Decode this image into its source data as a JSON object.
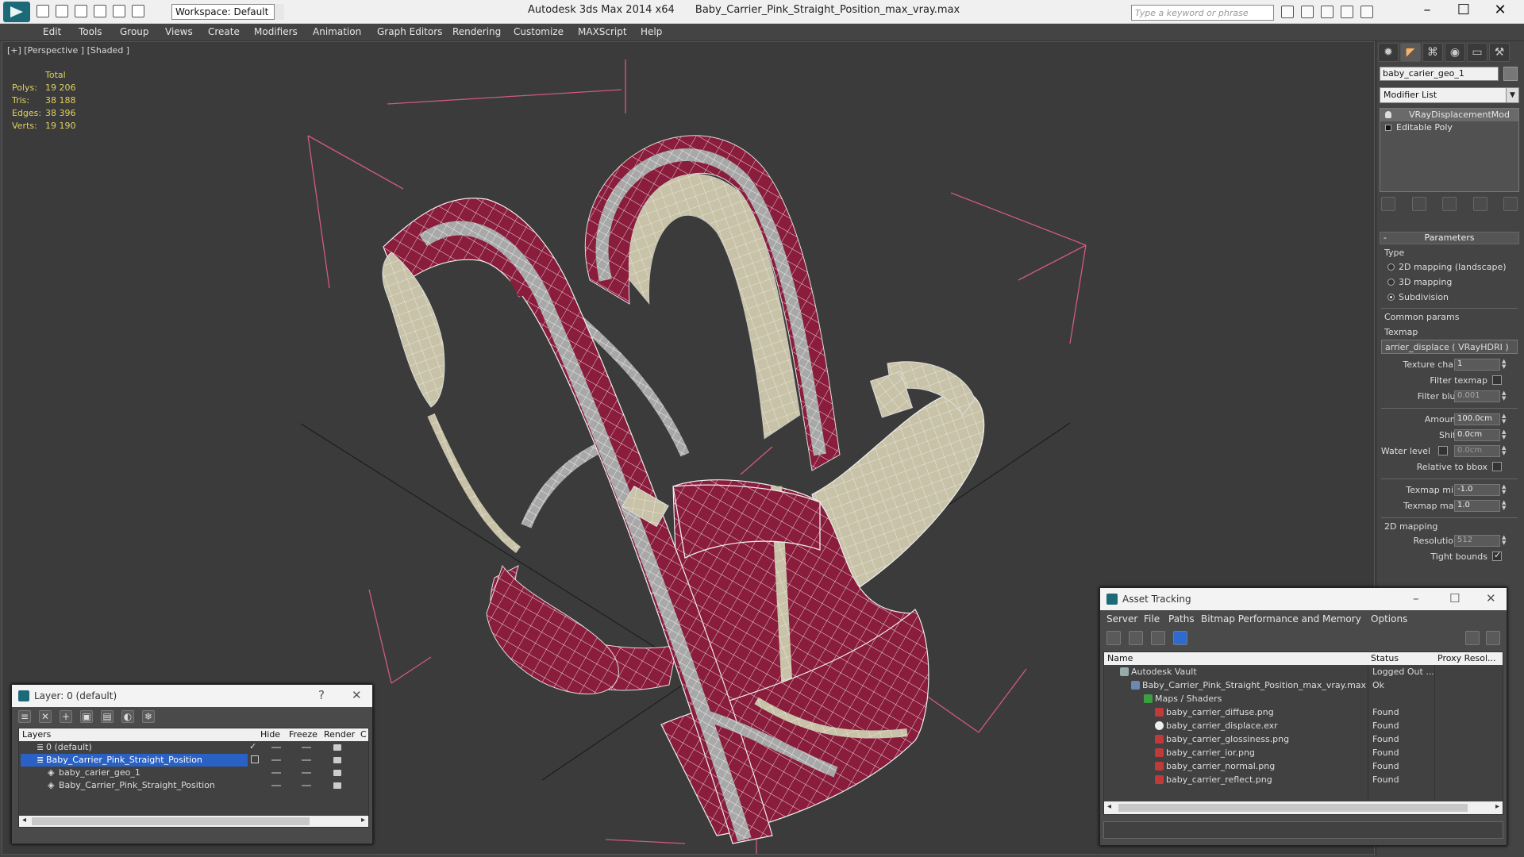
{
  "titlebar": {
    "workspace": "Workspace: Default",
    "app": "Autodesk 3ds Max  2014 x64",
    "file": "Baby_Carrier_Pink_Straight_Position_max_vray.max",
    "search_placeholder": "Type a keyword or phrase"
  },
  "menu": [
    "Edit",
    "Tools",
    "Group",
    "Views",
    "Create",
    "Modifiers",
    "Animation",
    "Graph Editors",
    "Rendering",
    "Customize",
    "MAXScript",
    "Help"
  ],
  "viewport": {
    "label": "[+] [Perspective ] [Shaded ]",
    "stats": {
      "header": "Total",
      "rows": [
        {
          "label": "Polys:",
          "value": "19 206"
        },
        {
          "label": "Tris:",
          "value": "38 188"
        },
        {
          "label": "Edges:",
          "value": "38 396"
        },
        {
          "label": "Verts:",
          "value": "19 190"
        }
      ]
    }
  },
  "command_panel": {
    "object_name": "baby_carier_geo_1",
    "modifier_list": "Modifier List",
    "stack": [
      "VRayDisplacementMod",
      "Editable Poly"
    ],
    "rollout": "Parameters",
    "type_group": "Type",
    "types": [
      "2D mapping (landscape)",
      "3D mapping",
      "Subdivision"
    ],
    "common_params": "Common params",
    "texmap_label": "Texmap",
    "texmap_value": "arrier_displace  ( VRayHDRI )",
    "fields": {
      "texture_chan": {
        "label": "Texture chan",
        "value": "1"
      },
      "filter_texmap": {
        "label": "Filter texmap"
      },
      "filter_blur": {
        "label": "Filter blur",
        "value": "0.001"
      },
      "amount": {
        "label": "Amount",
        "value": "100.0cm"
      },
      "shift": {
        "label": "Shift",
        "value": "0.0cm"
      },
      "water_level": {
        "label": "Water level",
        "value": "0.0cm"
      },
      "relative_bbox": {
        "label": "Relative to bbox"
      },
      "texmap_min": {
        "label": "Texmap min",
        "value": "-1.0"
      },
      "texmap_max": {
        "label": "Texmap max",
        "value": "1.0"
      }
    },
    "mapping_2d": "2D mapping",
    "resolution": {
      "label": "Resolution",
      "value": "512"
    },
    "tight_bounds": {
      "label": "Tight bounds"
    }
  },
  "layer_window": {
    "title": "Layer: 0 (default)",
    "help": "?",
    "columns": [
      "Layers",
      "Hide",
      "Freeze",
      "Render",
      "C"
    ],
    "rows": [
      {
        "name": "0 (default)",
        "indent": 1,
        "selected": false,
        "active": true
      },
      {
        "name": "Baby_Carrier_Pink_Straight_Position",
        "indent": 1,
        "selected": true,
        "active": false
      },
      {
        "name": "baby_carier_geo_1",
        "indent": 2,
        "selected": false,
        "active": false
      },
      {
        "name": "Baby_Carrier_Pink_Straight_Position",
        "indent": 2,
        "selected": false,
        "active": false
      }
    ]
  },
  "asset_window": {
    "title": "Asset Tracking",
    "menu": [
      "Server",
      "File",
      "Paths",
      "Bitmap Performance and Memory",
      "Options"
    ],
    "columns": [
      "Name",
      "Status",
      "Proxy Resol..."
    ],
    "rows": [
      {
        "name": "Autodesk Vault",
        "status": "Logged Out ...",
        "indent": 0,
        "icon": "vault-icon"
      },
      {
        "name": "Baby_Carrier_Pink_Straight_Position_max_vray.max",
        "status": "Ok",
        "indent": 1,
        "icon": "max-file-icon"
      },
      {
        "name": "Maps / Shaders",
        "status": "",
        "indent": 2,
        "icon": "maps-folder-icon"
      },
      {
        "name": "baby_carrier_diffuse.png",
        "status": "Found",
        "indent": 3,
        "icon": "png-icon"
      },
      {
        "name": "baby_carrier_displace.exr",
        "status": "Found",
        "indent": 3,
        "icon": "exr-icon"
      },
      {
        "name": "baby_carrier_glossiness.png",
        "status": "Found",
        "indent": 3,
        "icon": "png-icon"
      },
      {
        "name": "baby_carrier_ior.png",
        "status": "Found",
        "indent": 3,
        "icon": "png-icon"
      },
      {
        "name": "baby_carrier_normal.png",
        "status": "Found",
        "indent": 3,
        "icon": "png-icon"
      },
      {
        "name": "baby_carrier_reflect.png",
        "status": "Found",
        "indent": 3,
        "icon": "png-icon"
      }
    ]
  },
  "colors": {
    "fabric_pink": "#8a1c3c",
    "fabric_grey": "#a8a8a8",
    "lining": "#c8c2a8",
    "bbox": "#d05a80",
    "stats": "#e0d060"
  }
}
